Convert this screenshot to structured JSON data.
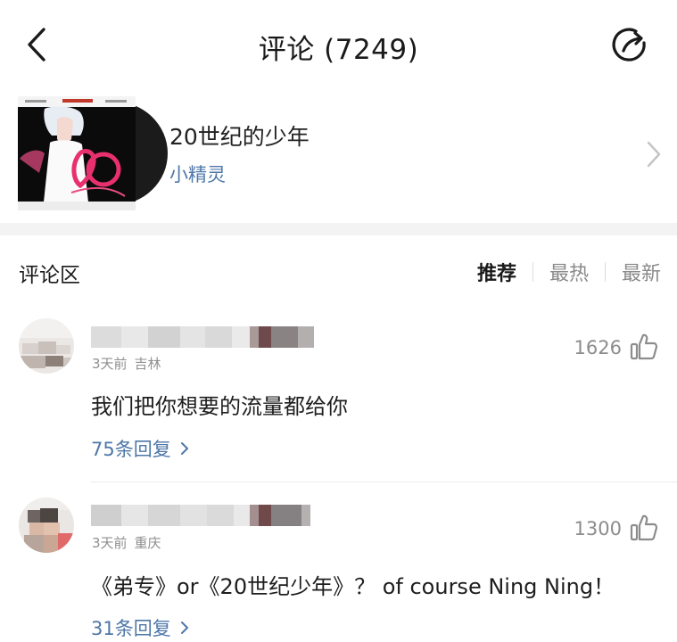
{
  "header": {
    "title": "评论 (7249)",
    "back_icon": "chevron-left-icon",
    "share_icon": "share-icon"
  },
  "song": {
    "title": "20世纪的少年",
    "artist": "小精灵",
    "cover_lettering": "20 Century Boy",
    "chevron_icon": "chevron-right-icon"
  },
  "comments_section": {
    "title": "评论区",
    "sort_tabs": [
      {
        "label": "推荐",
        "active": true
      },
      {
        "label": "最热",
        "active": false
      },
      {
        "label": "最新",
        "active": false
      }
    ]
  },
  "comments": [
    {
      "username": "",
      "username_blurred": true,
      "time": "3天前",
      "location": "吉林",
      "likes": "1626",
      "text": "我们把你想要的流量都给你",
      "replies": "75条回复"
    },
    {
      "username": "",
      "username_blurred": true,
      "time": "3天前",
      "location": "重庆",
      "likes": "1300",
      "text": "《弟专》or《20世纪少年》？ of course Ning Ning！",
      "replies": "31条回复"
    }
  ],
  "colors": {
    "link": "#4e77a8",
    "secondary_text": "#8f8f8f",
    "section_band": "#f3f3f3"
  }
}
